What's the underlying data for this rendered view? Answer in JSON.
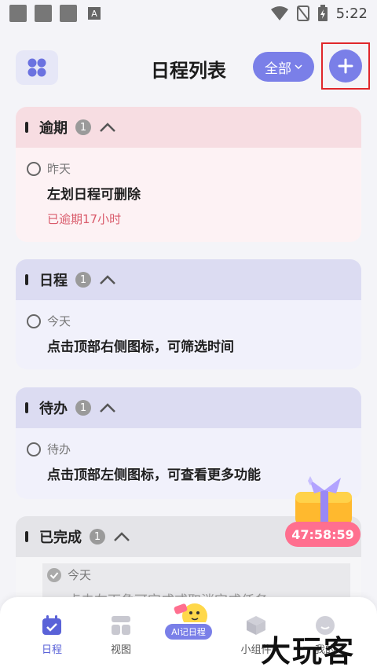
{
  "status": {
    "time": "5:22",
    "notif_letter": "A"
  },
  "header": {
    "title": "日程列表",
    "filter_label": "全部"
  },
  "sections": [
    {
      "title": "逾期",
      "count": "1",
      "day": "昨天",
      "item_title": "左划日程可删除",
      "note": "已逾期17小时"
    },
    {
      "title": "日程",
      "count": "1",
      "day": "今天",
      "item_title": "点击顶部右侧图标，可筛选时间"
    },
    {
      "title": "待办",
      "count": "1",
      "day": "待办",
      "item_title": "点击顶部左侧图标，可查看更多功能"
    },
    {
      "title": "已完成",
      "count": "1",
      "day": "今天",
      "item_title": "点击左下角可完成或取消完成任务"
    }
  ],
  "promo": {
    "timer": "47:58:59"
  },
  "nav": {
    "schedule": "日程",
    "view": "视图",
    "ai": "AI记日程",
    "widget": "小组件",
    "mine": "我的"
  },
  "watermark": "大玩客",
  "colors": {
    "accent": "#7a7fe8",
    "overdue_bg": "#f7dde2",
    "schedule_bg": "#dcdcf2",
    "done_bg": "#e4e4e8",
    "highlight": "#e0272b"
  }
}
